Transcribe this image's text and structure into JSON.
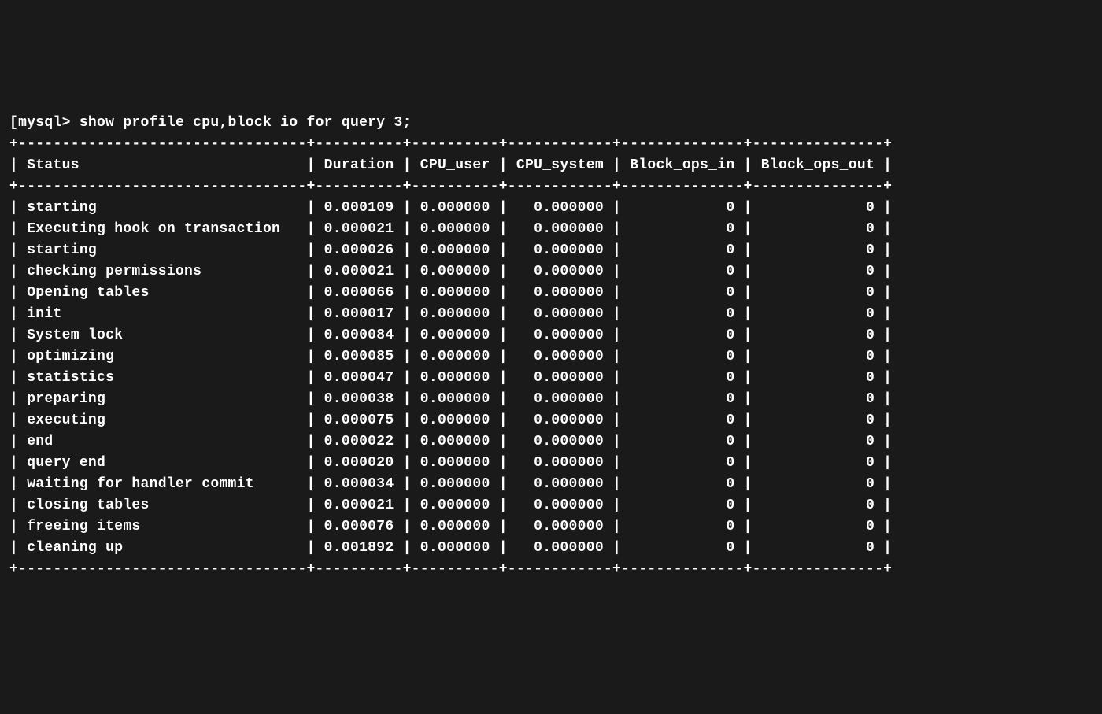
{
  "prompt_prefix": "[mysql> ",
  "command": "show profile cpu,block io for query 3;",
  "headers": [
    "Status",
    "Duration",
    "CPU_user",
    "CPU_system",
    "Block_ops_in",
    "Block_ops_out"
  ],
  "rows": [
    {
      "status": "starting",
      "duration": "0.000109",
      "cpu_user": "0.000000",
      "cpu_system": "0.000000",
      "block_ops_in": "0",
      "block_ops_out": "0"
    },
    {
      "status": "Executing hook on transaction",
      "duration": "0.000021",
      "cpu_user": "0.000000",
      "cpu_system": "0.000000",
      "block_ops_in": "0",
      "block_ops_out": "0"
    },
    {
      "status": "starting",
      "duration": "0.000026",
      "cpu_user": "0.000000",
      "cpu_system": "0.000000",
      "block_ops_in": "0",
      "block_ops_out": "0"
    },
    {
      "status": "checking permissions",
      "duration": "0.000021",
      "cpu_user": "0.000000",
      "cpu_system": "0.000000",
      "block_ops_in": "0",
      "block_ops_out": "0"
    },
    {
      "status": "Opening tables",
      "duration": "0.000066",
      "cpu_user": "0.000000",
      "cpu_system": "0.000000",
      "block_ops_in": "0",
      "block_ops_out": "0"
    },
    {
      "status": "init",
      "duration": "0.000017",
      "cpu_user": "0.000000",
      "cpu_system": "0.000000",
      "block_ops_in": "0",
      "block_ops_out": "0"
    },
    {
      "status": "System lock",
      "duration": "0.000084",
      "cpu_user": "0.000000",
      "cpu_system": "0.000000",
      "block_ops_in": "0",
      "block_ops_out": "0"
    },
    {
      "status": "optimizing",
      "duration": "0.000085",
      "cpu_user": "0.000000",
      "cpu_system": "0.000000",
      "block_ops_in": "0",
      "block_ops_out": "0"
    },
    {
      "status": "statistics",
      "duration": "0.000047",
      "cpu_user": "0.000000",
      "cpu_system": "0.000000",
      "block_ops_in": "0",
      "block_ops_out": "0"
    },
    {
      "status": "preparing",
      "duration": "0.000038",
      "cpu_user": "0.000000",
      "cpu_system": "0.000000",
      "block_ops_in": "0",
      "block_ops_out": "0"
    },
    {
      "status": "executing",
      "duration": "0.000075",
      "cpu_user": "0.000000",
      "cpu_system": "0.000000",
      "block_ops_in": "0",
      "block_ops_out": "0"
    },
    {
      "status": "end",
      "duration": "0.000022",
      "cpu_user": "0.000000",
      "cpu_system": "0.000000",
      "block_ops_in": "0",
      "block_ops_out": "0"
    },
    {
      "status": "query end",
      "duration": "0.000020",
      "cpu_user": "0.000000",
      "cpu_system": "0.000000",
      "block_ops_in": "0",
      "block_ops_out": "0"
    },
    {
      "status": "waiting for handler commit",
      "duration": "0.000034",
      "cpu_user": "0.000000",
      "cpu_system": "0.000000",
      "block_ops_in": "0",
      "block_ops_out": "0"
    },
    {
      "status": "closing tables",
      "duration": "0.000021",
      "cpu_user": "0.000000",
      "cpu_system": "0.000000",
      "block_ops_in": "0",
      "block_ops_out": "0"
    },
    {
      "status": "freeing items",
      "duration": "0.000076",
      "cpu_user": "0.000000",
      "cpu_system": "0.000000",
      "block_ops_in": "0",
      "block_ops_out": "0"
    },
    {
      "status": "cleaning up",
      "duration": "0.001892",
      "cpu_user": "0.000000",
      "cpu_system": "0.000000",
      "block_ops_in": "0",
      "block_ops_out": "0"
    }
  ],
  "col_widths": {
    "status": 33,
    "duration": 10,
    "cpu_user": 10,
    "cpu_system": 12,
    "block_ops_in": 14,
    "block_ops_out": 15
  }
}
